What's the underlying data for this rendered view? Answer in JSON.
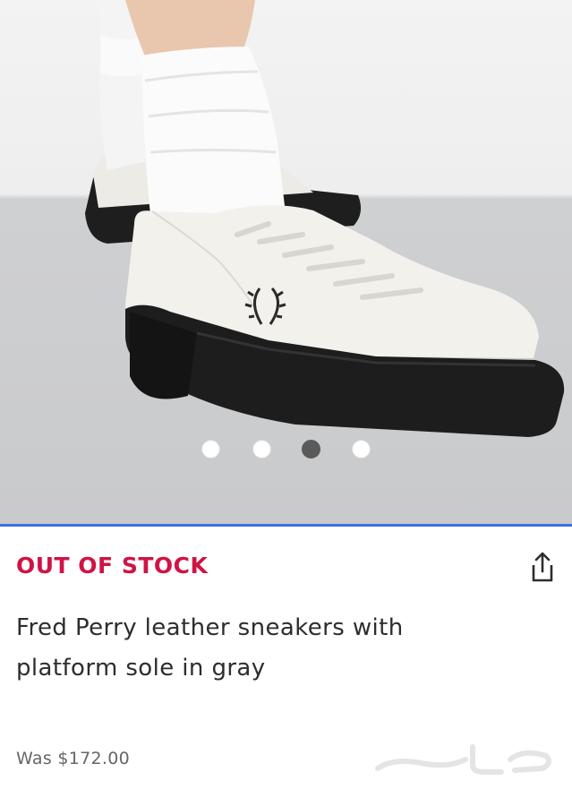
{
  "gallery": {
    "image_alt": "White leather sneakers with black platform sole",
    "slide_count": 4,
    "active_slide": 3
  },
  "product": {
    "stock_status": "OUT OF STOCK",
    "title_line1": "Fred Perry leather sneakers with",
    "title_line2": "platform sole in gray",
    "price_label": "Was $172.00"
  },
  "icons": {
    "share": "share-icon",
    "logo": "laurel-wreath-logo"
  },
  "watermark": {
    "text": "حراج"
  },
  "colors": {
    "stock_status": "#d01345",
    "divider": "#3b6fe0",
    "active_dot": "#5a5a5a"
  }
}
